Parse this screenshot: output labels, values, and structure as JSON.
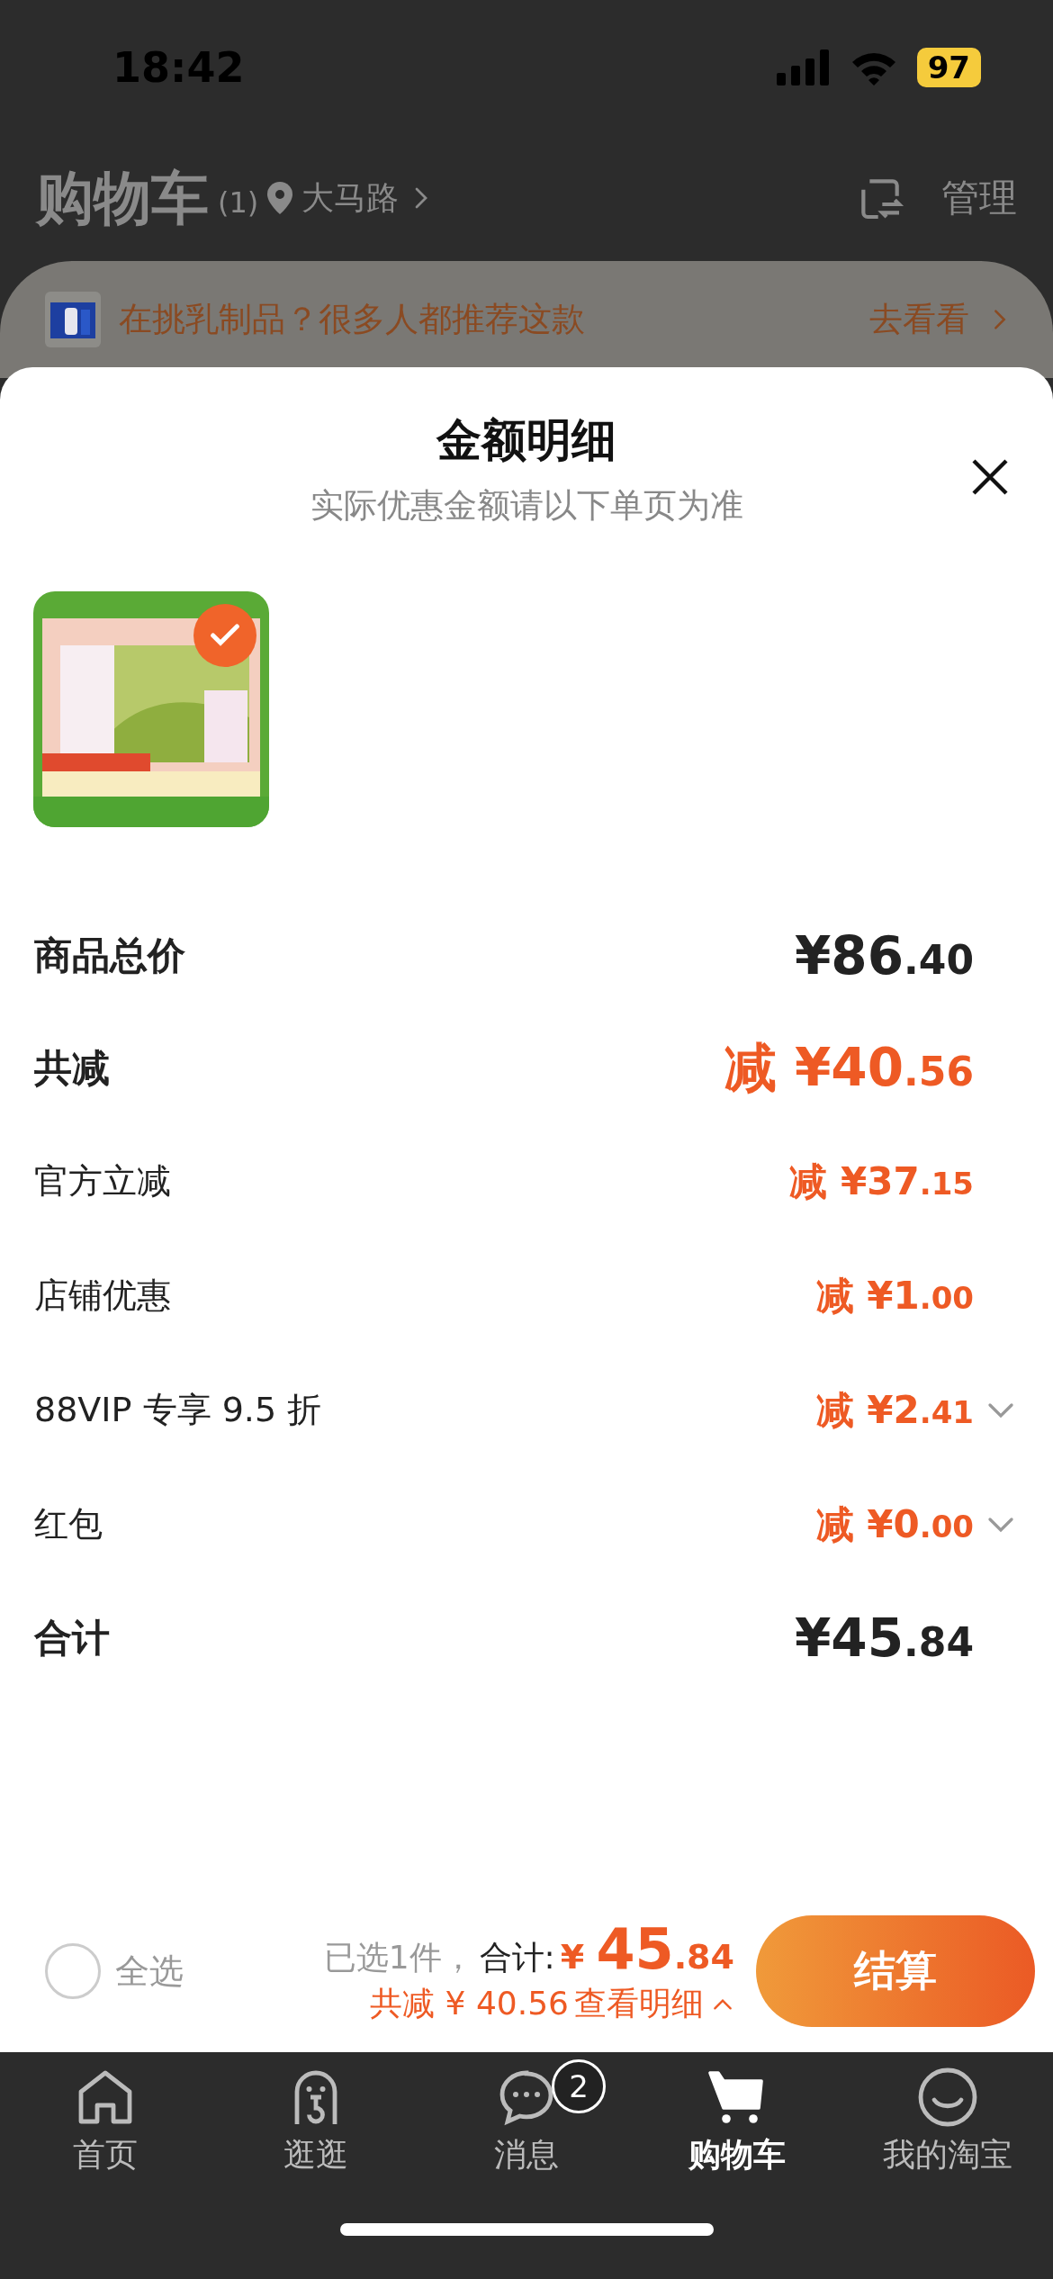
{
  "status_bar": {
    "time": "18:42",
    "battery": "97"
  },
  "header": {
    "title": "购物车",
    "count": "(1)",
    "location": "大马路",
    "manage": "管理"
  },
  "banner": {
    "text": "在挑乳制品？很多人都推荐这款",
    "action": "去看看"
  },
  "sheet": {
    "title": "金额明细",
    "subtitle": "实际优惠金额请以下单页为准",
    "product": {
      "kind": "picture",
      "selected": true
    },
    "rows": [
      {
        "kind": "sum",
        "label": "商品总价",
        "amount": "¥86.40"
      },
      {
        "kind": "discount_sum",
        "label": "共减",
        "minus": "减",
        "amount": "¥40.56"
      },
      {
        "kind": "discount",
        "label": "官方立减",
        "minus": "减",
        "amount": "¥37.15",
        "expandable": false
      },
      {
        "kind": "discount",
        "label": "店铺优惠",
        "minus": "减",
        "amount": "¥1.00",
        "expandable": false
      },
      {
        "kind": "discount",
        "label": "88VIP 专享 9.5 折",
        "minus": "减",
        "amount": "¥2.41",
        "expandable": true
      },
      {
        "kind": "discount",
        "label": "红包",
        "minus": "减",
        "amount": "¥0.00",
        "expandable": true
      },
      {
        "kind": "sum",
        "label": "合计",
        "amount": "¥45.84"
      }
    ]
  },
  "checkout": {
    "select_all": {
      "label": "全选",
      "checked": false
    },
    "selected_count": "已选1件，",
    "total_label": "合计:",
    "currency": "¥",
    "total": "45.84",
    "saved": "共减 ¥ 40.56",
    "details": "查看明细",
    "button": "结算"
  },
  "tab_bar": [
    {
      "label": "首页",
      "selected": false
    },
    {
      "label": "逛逛",
      "selected": false
    },
    {
      "label": "消息",
      "selected": false,
      "badge": "2"
    },
    {
      "label": "购物车",
      "selected": true
    },
    {
      "label": "我的淘宝",
      "selected": false
    }
  ]
}
